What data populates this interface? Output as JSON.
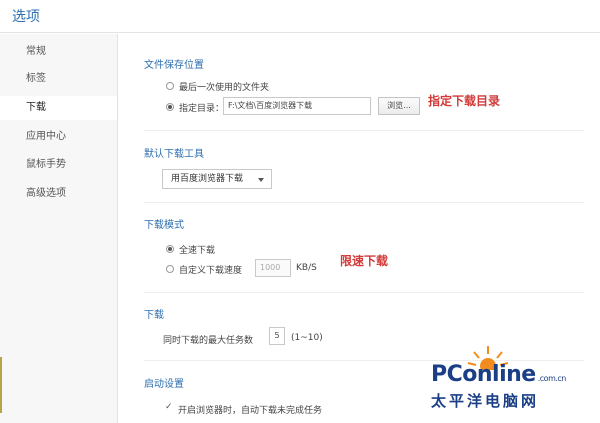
{
  "window": {
    "title": "选项"
  },
  "sidebar": {
    "items": [
      {
        "label": "常规"
      },
      {
        "label": "标签"
      },
      {
        "label": "下载"
      },
      {
        "label": "应用中心"
      },
      {
        "label": "鼠标手势"
      },
      {
        "label": "高级选项"
      }
    ],
    "active_index": 2
  },
  "save_location": {
    "title": "文件保存位置",
    "option_last": "最后一次使用的文件夹",
    "option_dir_label": "指定目录：",
    "dir_value": "F:\\文档\\百度浏览器下载",
    "browse_label": "浏览...",
    "selected": "option_dir"
  },
  "download_tool": {
    "title": "默认下载工具",
    "selected": "用百度浏览器下载"
  },
  "download_mode": {
    "title": "下载模式",
    "option_full": "全速下载",
    "option_custom": "自定义下载速度",
    "speed_value": "1000",
    "speed_unit": "KB/S",
    "selected": "option_full"
  },
  "download": {
    "title": "下载",
    "max_tasks_label": "同时下载的最大任务数",
    "max_tasks_value": "5",
    "max_tasks_range": "(1~10)"
  },
  "startup": {
    "title": "启动设置",
    "resume_label": "开启浏览器时，自动下载未完成任务",
    "resume_checked": true
  },
  "annotations": {
    "dir": "指定下载目录",
    "speed": "限速下载"
  },
  "watermark": {
    "brand_pc": "PC",
    "brand_online": "online",
    "brand_domain": ".com.cn",
    "brand_cn": "太平洋电脑网"
  },
  "colors": {
    "accent": "#2d6fb0",
    "annotation": "#d23a3a",
    "watermark": "#1b3f86"
  }
}
